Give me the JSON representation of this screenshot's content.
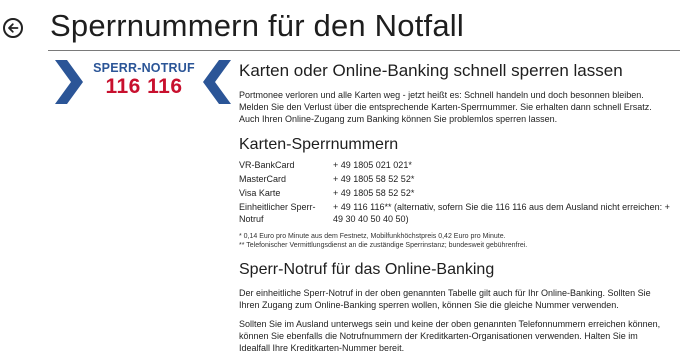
{
  "header": {
    "title": "Sperrnummern für den Notfall"
  },
  "logo": {
    "top_text": "SPERR-NOTRUF",
    "number": "116 116",
    "colors": {
      "blue": "#2b5597",
      "red": "#c8102e"
    }
  },
  "section_main": {
    "heading": "Karten oder Online-Banking schnell sperren lassen",
    "paragraph": "Portmonee verloren und alle Karten weg - jetzt heißt es: Schnell handeln und doch besonnen bleiben. Melden Sie den Verlust über die entsprechende Karten-Sperrnummer. Sie erhalten dann schnell Ersatz. Auch Ihren Online-Zugang zum Banking können Sie problemlos sperren lassen."
  },
  "cards": {
    "heading": "Karten-Sperrnummern",
    "rows": [
      {
        "name": "VR-BankCard",
        "number": "+ 49 1805 021 021*"
      },
      {
        "name": "MasterCard",
        "number": "+ 49 1805 58 52 52*"
      },
      {
        "name": "Visa Karte",
        "number": "+ 49 1805 58 52 52*"
      },
      {
        "name": "Einheitlicher Sperr-Notruf",
        "number": "+ 49 116 116** (alternativ, sofern Sie die 116 116 aus dem Ausland nicht erreichen: + 49 30 40 50 40 50)"
      }
    ],
    "note1": "* 0,14 Euro pro Minute aus dem Festnetz, Mobilfunkhöchstpreis 0,42 Euro pro Minute.",
    "note2": "** Telefonischer Vermittlungsdienst an die zuständige Sperrinstanz; bundesweit gebührenfrei."
  },
  "online": {
    "heading": "Sperr-Notruf für das Online-Banking",
    "paragraph1": "Der einheitliche Sperr-Notruf in der oben genannten Tabelle gilt auch für Ihr Online-Banking. Sollten Sie Ihren Zugang zum Online-Banking sperren wollen, können Sie die gleiche Nummer verwenden.",
    "paragraph2": "Sollten Sie im Ausland unterwegs sein und keine der oben genannten Telefonnummern erreichen können, können Sie ebenfalls die Notrufnummern der Kreditkarten-Organisationen verwenden. Halten Sie im Idealfall Ihre Kreditkarten-Nummer bereit."
  },
  "icons": {
    "back": "back-arrow-icon"
  }
}
